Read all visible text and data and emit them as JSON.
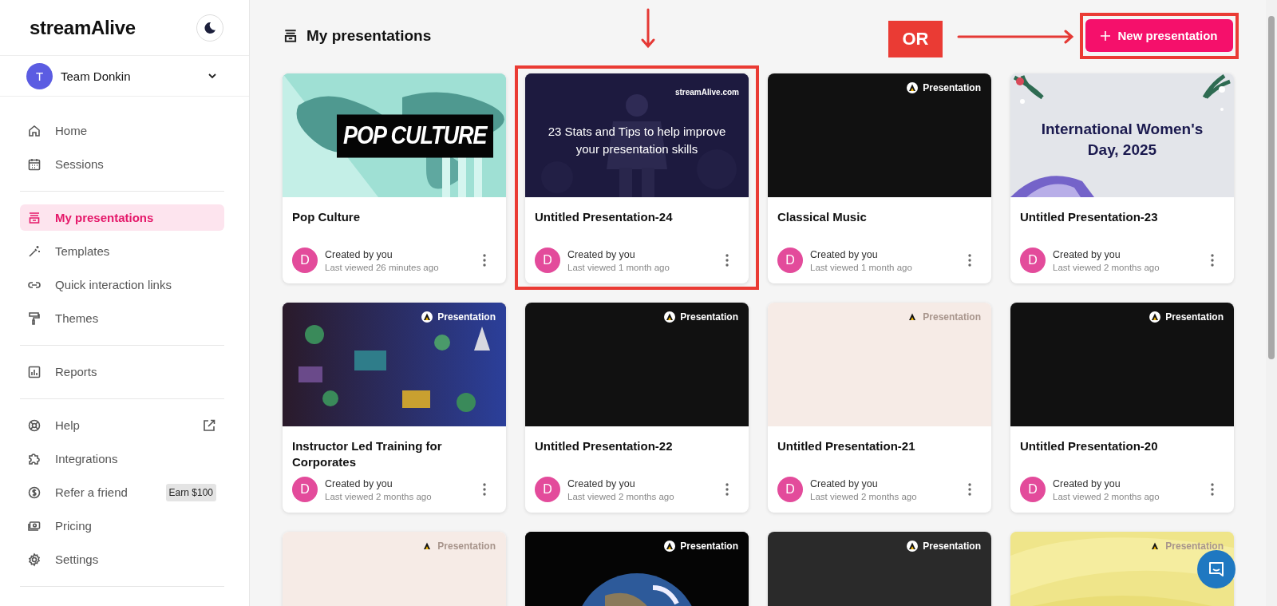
{
  "sidebar": {
    "logo": "streamAlive",
    "theme_toggle": {
      "dark": false
    },
    "team": {
      "initial": "T",
      "name": "Team Donkin"
    },
    "groups": [
      {
        "items": [
          {
            "label": "Home",
            "selected": false,
            "external": false
          },
          {
            "label": "Sessions",
            "selected": false,
            "external": false
          }
        ]
      },
      {
        "items": [
          {
            "label": "My presentations",
            "selected": true,
            "external": false
          },
          {
            "label": "Templates",
            "selected": false,
            "external": false
          },
          {
            "label": "Quick interaction links",
            "selected": false,
            "external": false
          },
          {
            "label": "Themes",
            "selected": false,
            "external": false
          }
        ]
      },
      {
        "items": [
          {
            "label": "Reports",
            "selected": false,
            "external": false
          }
        ]
      },
      {
        "items": [
          {
            "label": "Help",
            "selected": false,
            "external": true
          },
          {
            "label": "Integrations",
            "selected": false,
            "external": false
          },
          {
            "label": "Refer a friend",
            "selected": false,
            "external": false,
            "badge": "Earn $100"
          },
          {
            "label": "Pricing",
            "selected": false,
            "external": false
          },
          {
            "label": "Settings",
            "selected": false,
            "external": false
          }
        ]
      }
    ]
  },
  "main": {
    "title": "My presentations",
    "new_button": "New presentation",
    "annotation": {
      "or_label": "OR"
    },
    "cards": [
      {
        "title": "Pop Culture",
        "creator": "Created by you",
        "viewed": "Last viewed 26 minutes ago",
        "avatar": "D",
        "highlighted": false,
        "thumb": {
          "kind": "pop",
          "title": "POP CULTURE"
        }
      },
      {
        "title": "Untitled Presentation-24",
        "creator": "Created by you",
        "viewed": "Last viewed 1 month ago",
        "avatar": "D",
        "highlighted": true,
        "thumb": {
          "kind": "talk",
          "brand": "streamAlive.com",
          "title": "23 Stats and Tips to help improve your presentation skills"
        }
      },
      {
        "title": "Classical Music",
        "creator": "Created by you",
        "viewed": "Last viewed 1 month ago",
        "avatar": "D",
        "highlighted": false,
        "thumb": {
          "kind": "black",
          "badge": "Presentation"
        }
      },
      {
        "title": "Untitled Presentation-23",
        "creator": "Created by you",
        "viewed": "Last viewed 2 months ago",
        "avatar": "D",
        "highlighted": false,
        "thumb": {
          "kind": "women",
          "title": "International Women's Day, 2025"
        }
      },
      {
        "title": "Instructor Led Training for Corporates",
        "creator": "Created by you",
        "viewed": "Last viewed 2 months ago",
        "avatar": "D",
        "highlighted": false,
        "thumb": {
          "kind": "icons",
          "badge": "Presentation"
        }
      },
      {
        "title": "Untitled Presentation-22",
        "creator": "Created by you",
        "viewed": "Last viewed 2 months ago",
        "avatar": "D",
        "highlighted": false,
        "thumb": {
          "kind": "black",
          "badge": "Presentation"
        }
      },
      {
        "title": "Untitled Presentation-21",
        "creator": "Created by you",
        "viewed": "Last viewed 2 months ago",
        "avatar": "D",
        "highlighted": false,
        "thumb": {
          "kind": "cream",
          "badge": "Presentation"
        }
      },
      {
        "title": "Untitled Presentation-20",
        "creator": "Created by you",
        "viewed": "Last viewed 2 months ago",
        "avatar": "D",
        "highlighted": false,
        "thumb": {
          "kind": "black",
          "badge": "Presentation"
        }
      },
      {
        "thumb": {
          "kind": "cream",
          "badge": "Presentation"
        }
      },
      {
        "thumb": {
          "kind": "earth",
          "badge": "Presentation"
        }
      },
      {
        "thumb": {
          "kind": "charcoal",
          "badge": "Presentation"
        }
      },
      {
        "thumb": {
          "kind": "yellow",
          "badge": "Presentation"
        }
      }
    ]
  }
}
